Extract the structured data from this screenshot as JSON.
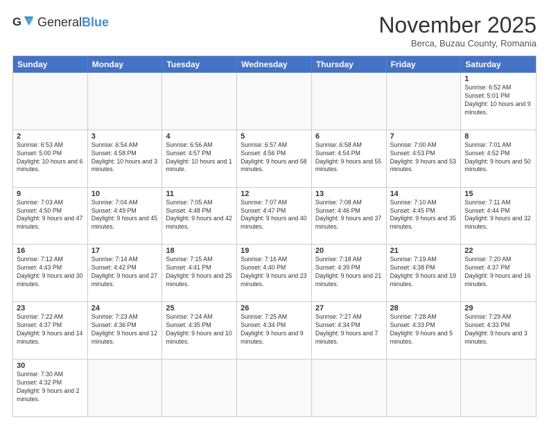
{
  "logo": {
    "text_general": "General",
    "text_blue": "Blue"
  },
  "title": "November 2025",
  "subtitle": "Berca, Buzau County, Romania",
  "header_days": [
    "Sunday",
    "Monday",
    "Tuesday",
    "Wednesday",
    "Thursday",
    "Friday",
    "Saturday"
  ],
  "rows": [
    [
      {
        "day": "",
        "info": ""
      },
      {
        "day": "",
        "info": ""
      },
      {
        "day": "",
        "info": ""
      },
      {
        "day": "",
        "info": ""
      },
      {
        "day": "",
        "info": ""
      },
      {
        "day": "",
        "info": ""
      },
      {
        "day": "1",
        "info": "Sunrise: 6:52 AM\nSunset: 5:01 PM\nDaylight: 10 hours and 9 minutes."
      }
    ],
    [
      {
        "day": "2",
        "info": "Sunrise: 6:53 AM\nSunset: 5:00 PM\nDaylight: 10 hours and 6 minutes."
      },
      {
        "day": "3",
        "info": "Sunrise: 6:54 AM\nSunset: 4:58 PM\nDaylight: 10 hours and 3 minutes."
      },
      {
        "day": "4",
        "info": "Sunrise: 6:56 AM\nSunset: 4:57 PM\nDaylight: 10 hours and 1 minute."
      },
      {
        "day": "5",
        "info": "Sunrise: 6:57 AM\nSunset: 4:56 PM\nDaylight: 9 hours and 58 minutes."
      },
      {
        "day": "6",
        "info": "Sunrise: 6:58 AM\nSunset: 4:54 PM\nDaylight: 9 hours and 55 minutes."
      },
      {
        "day": "7",
        "info": "Sunrise: 7:00 AM\nSunset: 4:53 PM\nDaylight: 9 hours and 53 minutes."
      },
      {
        "day": "8",
        "info": "Sunrise: 7:01 AM\nSunset: 4:52 PM\nDaylight: 9 hours and 50 minutes."
      }
    ],
    [
      {
        "day": "9",
        "info": "Sunrise: 7:03 AM\nSunset: 4:50 PM\nDaylight: 9 hours and 47 minutes."
      },
      {
        "day": "10",
        "info": "Sunrise: 7:04 AM\nSunset: 4:49 PM\nDaylight: 9 hours and 45 minutes."
      },
      {
        "day": "11",
        "info": "Sunrise: 7:05 AM\nSunset: 4:48 PM\nDaylight: 9 hours and 42 minutes."
      },
      {
        "day": "12",
        "info": "Sunrise: 7:07 AM\nSunset: 4:47 PM\nDaylight: 9 hours and 40 minutes."
      },
      {
        "day": "13",
        "info": "Sunrise: 7:08 AM\nSunset: 4:46 PM\nDaylight: 9 hours and 37 minutes."
      },
      {
        "day": "14",
        "info": "Sunrise: 7:10 AM\nSunset: 4:45 PM\nDaylight: 9 hours and 35 minutes."
      },
      {
        "day": "15",
        "info": "Sunrise: 7:11 AM\nSunset: 4:44 PM\nDaylight: 9 hours and 32 minutes."
      }
    ],
    [
      {
        "day": "16",
        "info": "Sunrise: 7:12 AM\nSunset: 4:43 PM\nDaylight: 9 hours and 30 minutes."
      },
      {
        "day": "17",
        "info": "Sunrise: 7:14 AM\nSunset: 4:42 PM\nDaylight: 9 hours and 27 minutes."
      },
      {
        "day": "18",
        "info": "Sunrise: 7:15 AM\nSunset: 4:41 PM\nDaylight: 9 hours and 25 minutes."
      },
      {
        "day": "19",
        "info": "Sunrise: 7:16 AM\nSunset: 4:40 PM\nDaylight: 9 hours and 23 minutes."
      },
      {
        "day": "20",
        "info": "Sunrise: 7:18 AM\nSunset: 4:39 PM\nDaylight: 9 hours and 21 minutes."
      },
      {
        "day": "21",
        "info": "Sunrise: 7:19 AM\nSunset: 4:38 PM\nDaylight: 9 hours and 19 minutes."
      },
      {
        "day": "22",
        "info": "Sunrise: 7:20 AM\nSunset: 4:37 PM\nDaylight: 9 hours and 16 minutes."
      }
    ],
    [
      {
        "day": "23",
        "info": "Sunrise: 7:22 AM\nSunset: 4:37 PM\nDaylight: 9 hours and 14 minutes."
      },
      {
        "day": "24",
        "info": "Sunrise: 7:23 AM\nSunset: 4:36 PM\nDaylight: 9 hours and 12 minutes."
      },
      {
        "day": "25",
        "info": "Sunrise: 7:24 AM\nSunset: 4:35 PM\nDaylight: 9 hours and 10 minutes."
      },
      {
        "day": "26",
        "info": "Sunrise: 7:25 AM\nSunset: 4:34 PM\nDaylight: 9 hours and 9 minutes."
      },
      {
        "day": "27",
        "info": "Sunrise: 7:27 AM\nSunset: 4:34 PM\nDaylight: 9 hours and 7 minutes."
      },
      {
        "day": "28",
        "info": "Sunrise: 7:28 AM\nSunset: 4:33 PM\nDaylight: 9 hours and 5 minutes."
      },
      {
        "day": "29",
        "info": "Sunrise: 7:29 AM\nSunset: 4:33 PM\nDaylight: 9 hours and 3 minutes."
      }
    ],
    [
      {
        "day": "30",
        "info": "Sunrise: 7:30 AM\nSunset: 4:32 PM\nDaylight: 9 hours and 2 minutes."
      },
      {
        "day": "",
        "info": ""
      },
      {
        "day": "",
        "info": ""
      },
      {
        "day": "",
        "info": ""
      },
      {
        "day": "",
        "info": ""
      },
      {
        "day": "",
        "info": ""
      },
      {
        "day": "",
        "info": ""
      }
    ]
  ]
}
